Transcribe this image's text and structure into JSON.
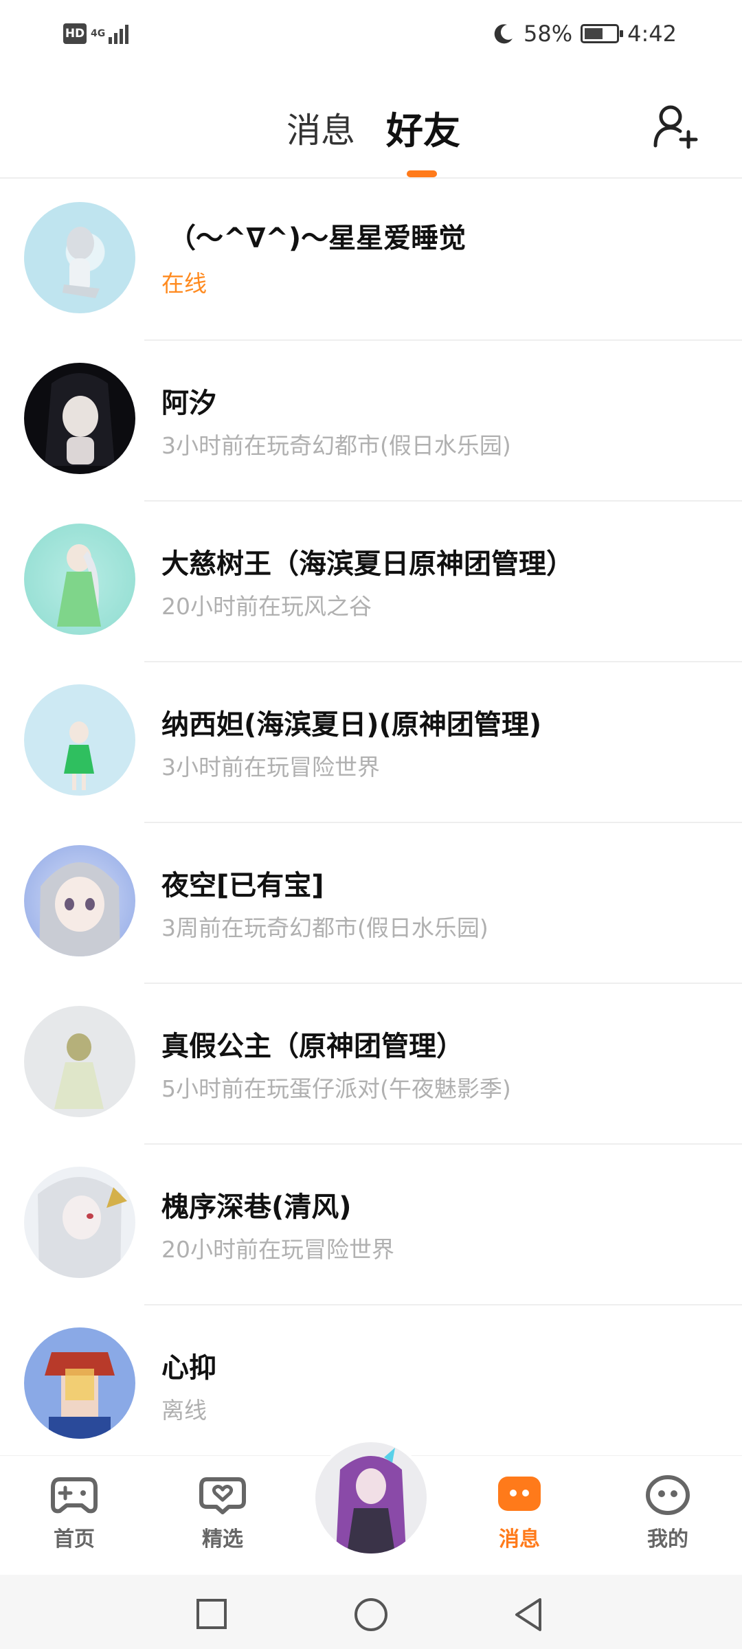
{
  "status_bar": {
    "hd": "HD",
    "network": "4G",
    "battery": "58%",
    "battery_level": 0.58,
    "time": "4:42",
    "icons": [
      "moon-icon",
      "battery-icon"
    ]
  },
  "header": {
    "tabs": [
      {
        "label": "消息",
        "active": false
      },
      {
        "label": "好友",
        "active": true
      }
    ],
    "add_friend_icon": "add-user-icon",
    "accent_color": "#ff7a1a"
  },
  "friends": [
    {
      "name": "（〜^∇^)〜星星爱睡觉",
      "status": "在线",
      "online": true
    },
    {
      "name": "阿汐",
      "status": "3小时前在玩奇幻都市(假日水乐园)",
      "online": false
    },
    {
      "name": "大慈树王（海滨夏日原神团管理）",
      "status": "20小时前在玩风之谷",
      "online": false
    },
    {
      "name": "纳西妲(海滨夏日)(原神团管理)",
      "status": "3小时前在玩冒险世界",
      "online": false
    },
    {
      "name": "夜空[已有宝]",
      "status": "3周前在玩奇幻都市(假日水乐园)",
      "online": false
    },
    {
      "name": "真假公主（原神团管理）",
      "status": "5小时前在玩蛋仔派对(午夜魅影季)",
      "online": false
    },
    {
      "name": "槐序深巷(清风)",
      "status": "20小时前在玩冒险世界",
      "online": false
    },
    {
      "name": "心抑",
      "status": "离线",
      "online": false
    }
  ],
  "bottom_nav": {
    "items": [
      {
        "label": "首页",
        "icon": "gamepad-icon",
        "active": false
      },
      {
        "label": "精选",
        "icon": "heart-chat-icon",
        "active": false
      },
      {
        "label": "消息",
        "icon": "message-icon",
        "active": true
      },
      {
        "label": "我的",
        "icon": "face-icon",
        "active": false
      }
    ]
  },
  "system_nav": [
    "recent-apps-icon",
    "home-icon",
    "back-icon"
  ]
}
